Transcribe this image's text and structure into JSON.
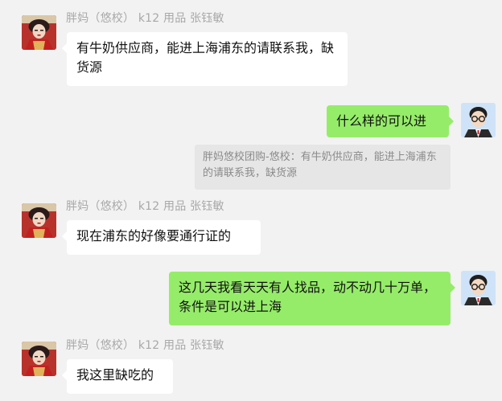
{
  "messages": [
    {
      "sender": "胖妈（悠校）  k12 用品  张钰敏",
      "text": "有牛奶供应商，能进上海浦东的请联系我，缺货源"
    },
    {
      "text": "什么样的可以进",
      "quote": "胖妈悠校团购-悠校：有牛奶供应商，能进上海浦东的请联系我，缺货源"
    },
    {
      "sender": "胖妈（悠校）  k12 用品  张钰敏",
      "text": "现在浦东的好像要通行证的"
    },
    {
      "text": "这几天我看天天有人找品，动不动几十万单，条件是可以进上海"
    },
    {
      "sender": "胖妈（悠校）  k12 用品  张钰敏",
      "text": "我这里缺吃的"
    }
  ],
  "colors": {
    "background": "#f2f2f2",
    "incoming_bubble": "#ffffff",
    "outgoing_bubble": "#95ec69",
    "quote_bg": "#e6e6e6"
  }
}
